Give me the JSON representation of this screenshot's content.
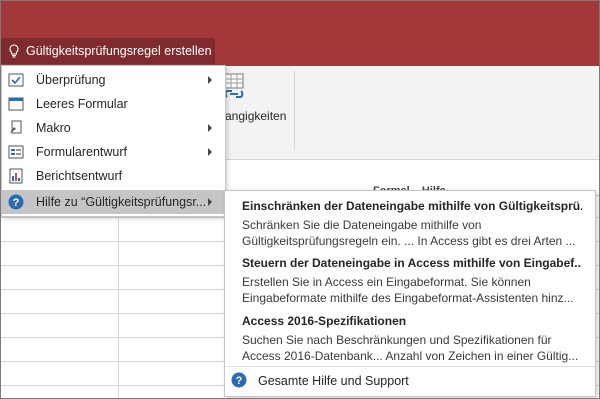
{
  "tellme": {
    "text": "Gültigkeitsprüfungsregel erstellen"
  },
  "ribbon": {
    "dependencies_label": "angigkeiten"
  },
  "sheet": {
    "column_header_fragment": "Formel... Hilfe..."
  },
  "menu": {
    "items": [
      {
        "label": "Überprüfung",
        "icon": "validation-icon",
        "submenu": true
      },
      {
        "label": "Leeres Formular",
        "icon": "blank-form-icon",
        "submenu": false
      },
      {
        "label": "Makro",
        "icon": "macro-icon",
        "submenu": true
      },
      {
        "label": "Formularentwurf",
        "icon": "form-design-icon",
        "submenu": true
      },
      {
        "label": "Berichtsentwurf",
        "icon": "report-design-icon",
        "submenu": false
      },
      {
        "label": "Hilfe zu “Gültigkeitsprüfungsr...",
        "icon": "help-icon",
        "submenu": true,
        "selected": true
      }
    ]
  },
  "submenu": {
    "results": [
      {
        "title": "Einschränken der Dateneingabe mithilfe von Gültigkeitsprü...",
        "line1": "Schränken Sie die Dateneingabe mithilfe von",
        "line2": "Gültigkeitsprüfungsregeln ein. ... In Access gibt es drei Arten ..."
      },
      {
        "title": "Steuern der Dateneingabe in Access mithilfe von Eingabef...",
        "line1": "Erstellen Sie in Access ein Eingabeformat. Sie können",
        "line2": "Eingabeformate mithilfe des Eingabeformat-Assistenten hinz..."
      },
      {
        "title": "Access 2016-Spezifikationen",
        "line1": "Suchen Sie nach Beschränkungen und Spezifikationen für",
        "line2": "Access 2016-Datenbank... Anzahl von Zeichen in einer Gültig..."
      }
    ],
    "help_label": "Gesamte Hilfe und Support"
  },
  "colors": {
    "title_bar": "#a4373a",
    "tellme_bg": "#7f2a2d",
    "help_blue": "#2b6cb4"
  }
}
